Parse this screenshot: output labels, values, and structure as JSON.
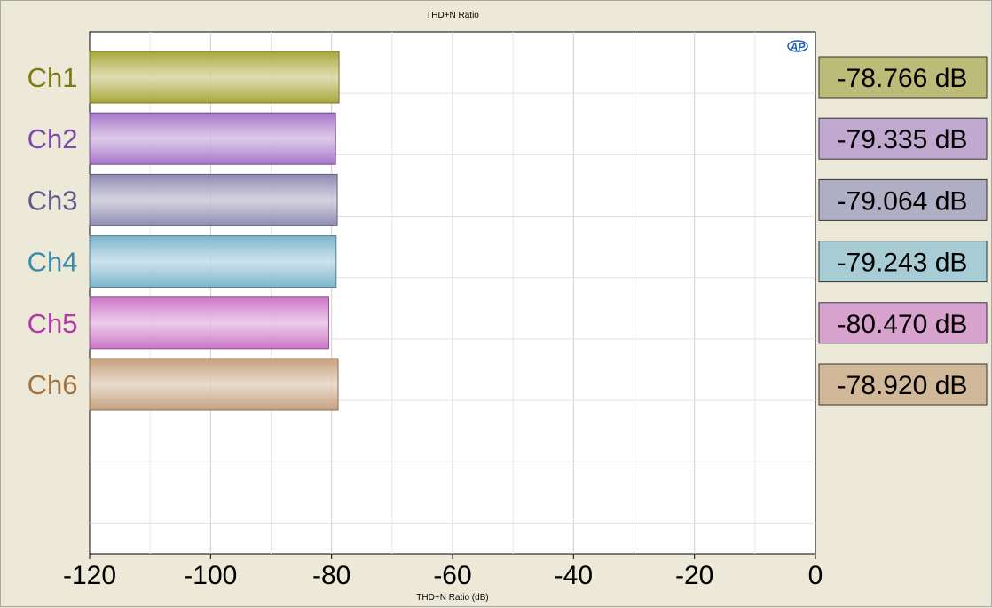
{
  "chart_data": {
    "type": "bar",
    "orientation": "horizontal",
    "title": "THD+N Ratio",
    "xlabel": "THD+N Ratio (dB)",
    "ylabel": "",
    "xlim": [
      -120,
      0
    ],
    "xticks": [
      "-120",
      "-100",
      "-80",
      "-60",
      "-40",
      "-20",
      "0"
    ],
    "grid": true,
    "categories": [
      "Ch1",
      "Ch2",
      "Ch3",
      "Ch4",
      "Ch5",
      "Ch6"
    ],
    "values": [
      -78.766,
      -79.335,
      -79.064,
      -79.243,
      -80.47,
      -78.92
    ],
    "value_labels": [
      "-78.766 dB",
      "-79.335 dB",
      "-79.064 dB",
      "-79.243 dB",
      "-80.470 dB",
      "-78.920 dB"
    ],
    "colors": [
      "#a8a638",
      "#a674c8",
      "#8e8ab0",
      "#7cb4cc",
      "#cc76c8",
      "#c6a07c"
    ],
    "label_colors": [
      "#7c7a14",
      "#7c4aa8",
      "#5e5a8c",
      "#3a8aaa",
      "#b23aa8",
      "#a07442"
    ],
    "value_box_colors": [
      "#bdbb78",
      "#c0a8d0",
      "#b0aec4",
      "#a8ccd4",
      "#d8a2cf",
      "#d0b898"
    ],
    "logo": "AP"
  }
}
